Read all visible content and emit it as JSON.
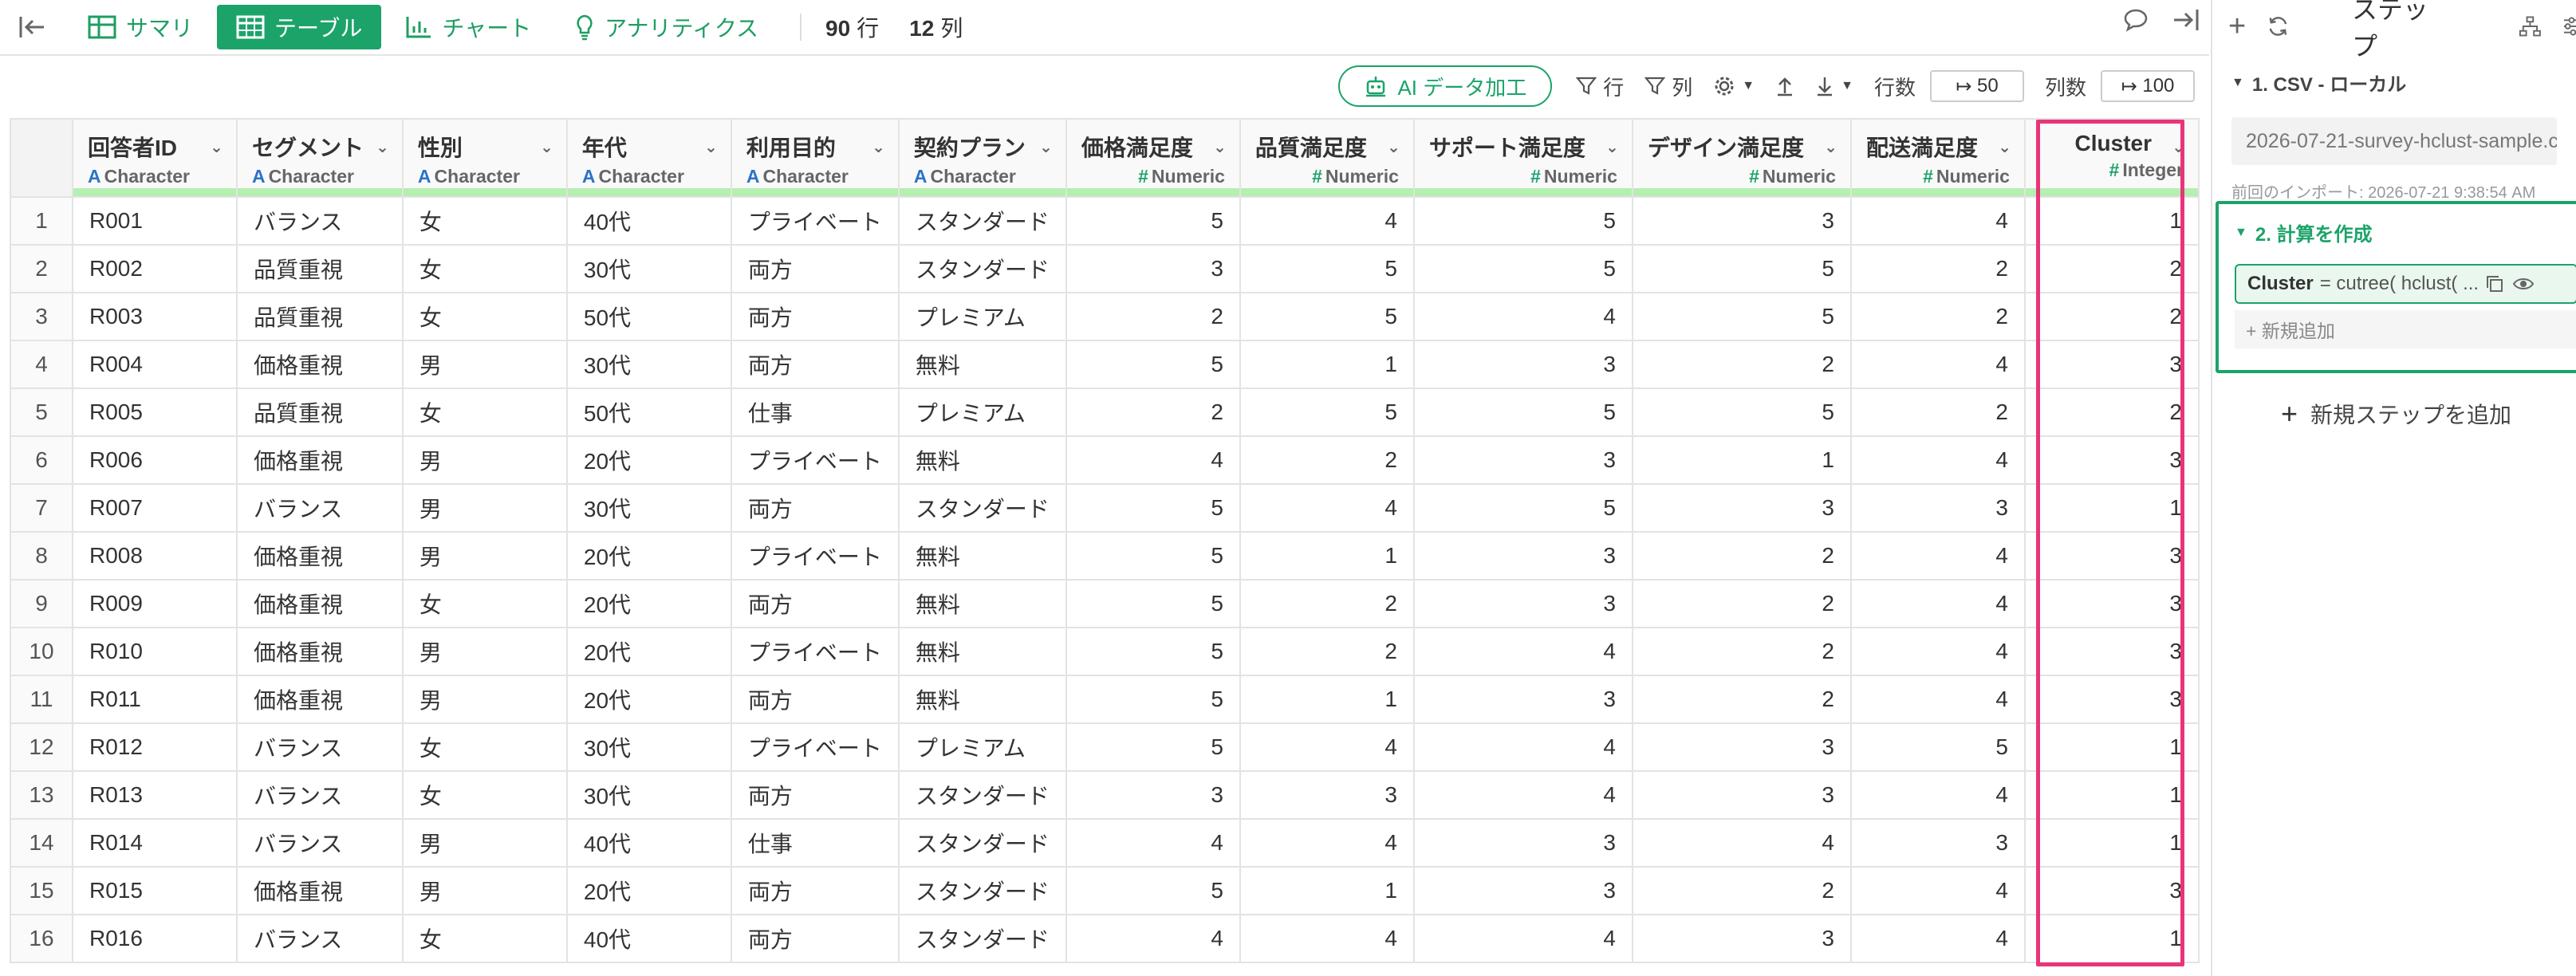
{
  "topbar": {
    "tabs": [
      {
        "label": "サマリ",
        "icon": "summary-icon",
        "active": false
      },
      {
        "label": "テーブル",
        "icon": "table-icon",
        "active": true
      },
      {
        "label": "チャート",
        "icon": "chart-icon",
        "active": false
      },
      {
        "label": "アナリティクス",
        "icon": "lightbulb-icon",
        "active": false
      }
    ],
    "rows_count": "90",
    "rows_unit": "行",
    "cols_count": "12",
    "cols_unit": "列"
  },
  "toolbar": {
    "ai_label": "AI データ加工",
    "row_filter_label": "行",
    "col_filter_label": "列",
    "rows_label": "行数",
    "rows_value": "50",
    "cols_label": "列数",
    "cols_value": "100"
  },
  "table": {
    "columns": [
      {
        "name": "回答者ID",
        "type": "Character",
        "kind": "char"
      },
      {
        "name": "セグメント",
        "type": "Character",
        "kind": "char"
      },
      {
        "name": "性別",
        "type": "Character",
        "kind": "char"
      },
      {
        "name": "年代",
        "type": "Character",
        "kind": "char"
      },
      {
        "name": "利用目的",
        "type": "Character",
        "kind": "char"
      },
      {
        "name": "契約プラン",
        "type": "Character",
        "kind": "char"
      },
      {
        "name": "価格満足度",
        "type": "Numeric",
        "kind": "num"
      },
      {
        "name": "品質満足度",
        "type": "Numeric",
        "kind": "num"
      },
      {
        "name": "サポート満足度",
        "type": "Numeric",
        "kind": "num"
      },
      {
        "name": "デザイン満足度",
        "type": "Numeric",
        "kind": "num"
      },
      {
        "name": "配送満足度",
        "type": "Numeric",
        "kind": "num"
      },
      {
        "name": "Cluster",
        "type": "Integer",
        "kind": "num"
      }
    ],
    "rows": [
      [
        "1",
        "R001",
        "バランス",
        "女",
        "40代",
        "プライベート",
        "スタンダード",
        "5",
        "4",
        "5",
        "3",
        "4",
        "1"
      ],
      [
        "2",
        "R002",
        "品質重視",
        "女",
        "30代",
        "両方",
        "スタンダード",
        "3",
        "5",
        "5",
        "5",
        "2",
        "2"
      ],
      [
        "3",
        "R003",
        "品質重視",
        "女",
        "50代",
        "両方",
        "プレミアム",
        "2",
        "5",
        "4",
        "5",
        "2",
        "2"
      ],
      [
        "4",
        "R004",
        "価格重視",
        "男",
        "30代",
        "両方",
        "無料",
        "5",
        "1",
        "3",
        "2",
        "4",
        "3"
      ],
      [
        "5",
        "R005",
        "品質重視",
        "女",
        "50代",
        "仕事",
        "プレミアム",
        "2",
        "5",
        "5",
        "5",
        "2",
        "2"
      ],
      [
        "6",
        "R006",
        "価格重視",
        "男",
        "20代",
        "プライベート",
        "無料",
        "4",
        "2",
        "3",
        "1",
        "4",
        "3"
      ],
      [
        "7",
        "R007",
        "バランス",
        "男",
        "30代",
        "両方",
        "スタンダード",
        "5",
        "4",
        "5",
        "3",
        "3",
        "1"
      ],
      [
        "8",
        "R008",
        "価格重視",
        "男",
        "20代",
        "プライベート",
        "無料",
        "5",
        "1",
        "3",
        "2",
        "4",
        "3"
      ],
      [
        "9",
        "R009",
        "価格重視",
        "女",
        "20代",
        "両方",
        "無料",
        "5",
        "2",
        "3",
        "2",
        "4",
        "3"
      ],
      [
        "10",
        "R010",
        "価格重視",
        "男",
        "20代",
        "プライベート",
        "無料",
        "5",
        "2",
        "4",
        "2",
        "4",
        "3"
      ],
      [
        "11",
        "R011",
        "価格重視",
        "男",
        "20代",
        "両方",
        "無料",
        "5",
        "1",
        "3",
        "2",
        "4",
        "3"
      ],
      [
        "12",
        "R012",
        "バランス",
        "女",
        "30代",
        "プライベート",
        "プレミアム",
        "5",
        "4",
        "4",
        "3",
        "5",
        "1"
      ],
      [
        "13",
        "R013",
        "バランス",
        "女",
        "30代",
        "両方",
        "スタンダード",
        "3",
        "3",
        "4",
        "3",
        "4",
        "1"
      ],
      [
        "14",
        "R014",
        "バランス",
        "男",
        "40代",
        "仕事",
        "スタンダード",
        "4",
        "4",
        "3",
        "4",
        "3",
        "1"
      ],
      [
        "15",
        "R015",
        "価格重視",
        "男",
        "20代",
        "両方",
        "スタンダード",
        "5",
        "1",
        "3",
        "2",
        "4",
        "3"
      ],
      [
        "16",
        "R016",
        "バランス",
        "女",
        "40代",
        "両方",
        "スタンダード",
        "4",
        "4",
        "4",
        "3",
        "4",
        "1"
      ]
    ]
  },
  "panel": {
    "title": "ステップ",
    "step1_title": "1. CSV - ローカル",
    "file_name": "2026-07-21-survey-hclust-sample.c...",
    "import_time": "前回のインポート: 2026-07-21 9:38:54 AM",
    "step2_title": "2. 計算を作成",
    "calc_name": "Cluster",
    "calc_expr": "= cutree( hclust( ...",
    "add_new_label": "+ 新規追加",
    "add_step_label": "新規ステップを追加"
  },
  "colors": {
    "accent": "#1ca36a",
    "highlight": "#e8357a"
  }
}
